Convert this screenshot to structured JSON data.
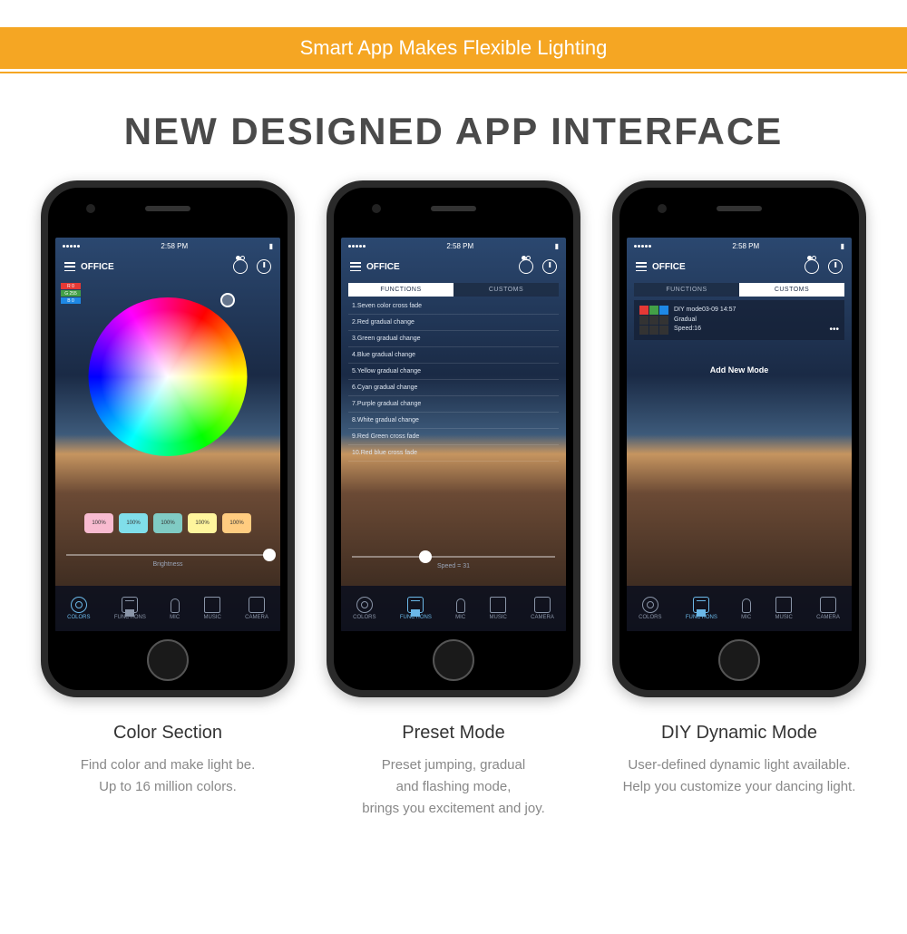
{
  "banner": "Smart App Makes Flexible Lighting",
  "main_title": "NEW DESIGNED APP INTERFACE",
  "status": {
    "time": "2:58 PM"
  },
  "appbar": {
    "title": "OFFICE"
  },
  "nav": [
    {
      "label": "COLORS"
    },
    {
      "label": "FUNCTIONS"
    },
    {
      "label": "MIC"
    },
    {
      "label": "MUSIC"
    },
    {
      "label": "CAMERA"
    }
  ],
  "phone1": {
    "rgb": [
      {
        "label": "R",
        "val": "0",
        "color": "#e53935"
      },
      {
        "label": "G",
        "val": "255",
        "color": "#43a047"
      },
      {
        "label": "B",
        "val": "0",
        "color": "#1e88e5"
      }
    ],
    "chips": [
      {
        "label": "100%",
        "color": "#f8bbd0"
      },
      {
        "label": "100%",
        "color": "#80deea"
      },
      {
        "label": "100%",
        "color": "#80cbc4"
      },
      {
        "label": "100%",
        "color": "#fff59d"
      },
      {
        "label": "100%",
        "color": "#ffcc80"
      }
    ],
    "slider_label": "Brightness"
  },
  "phone2": {
    "tabs": {
      "left": "FUNCTIONS",
      "right": "CUSTOMS"
    },
    "presets": [
      "1.Seven color cross fade",
      "2.Red gradual change",
      "3.Green gradual change",
      "4.Blue gradual change",
      "5.Yellow gradual change",
      "6.Cyan gradual change",
      "7.Purple gradual change",
      "8.White gradual change",
      "9.Red Green cross fade",
      "10.Red blue cross fade"
    ],
    "speed_label": "Speed = 31"
  },
  "phone3": {
    "tabs": {
      "left": "FUNCTIONS",
      "right": "CUSTOMS"
    },
    "diy": {
      "title": "DIY mode03-09 14:57",
      "sub1": "Gradual",
      "sub2": "Speed:16",
      "swatches": [
        "#e53935",
        "#43a047",
        "#1e88e5",
        "#333",
        "#333",
        "#333",
        "#333",
        "#333",
        "#333"
      ]
    },
    "add_label": "Add New Mode"
  },
  "captions": [
    {
      "title": "Color Section",
      "desc": "Find color and make light be.\nUp to 16 million colors."
    },
    {
      "title": "Preset Mode",
      "desc": "Preset jumping, gradual\nand flashing mode,\nbrings you excitement and joy."
    },
    {
      "title": "DIY Dynamic Mode",
      "desc": "User-defined dynamic light available.\nHelp you customize your dancing light."
    }
  ]
}
